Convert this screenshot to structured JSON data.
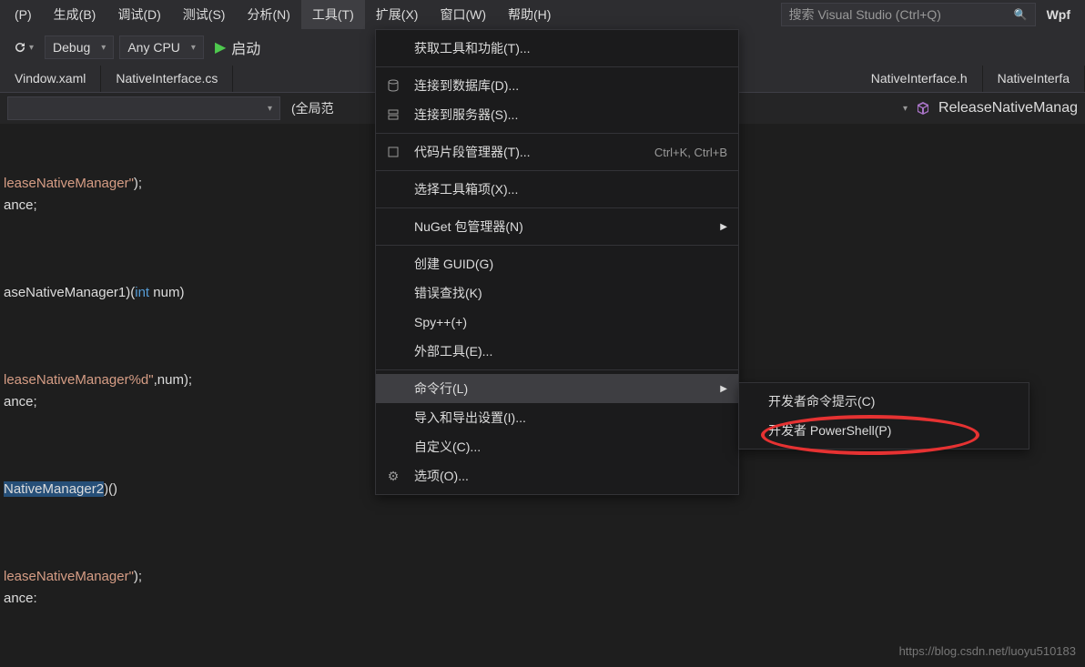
{
  "menubar": {
    "items": [
      "(P)",
      "生成(B)",
      "调试(D)",
      "测试(S)",
      "分析(N)",
      "工具(T)",
      "扩展(X)",
      "窗口(W)",
      "帮助(H)"
    ],
    "activeIndex": 5,
    "searchPlaceholder": "搜索 Visual Studio (Ctrl+Q)",
    "appTitle": "Wpf"
  },
  "toolbar": {
    "config": "Debug",
    "platform": "Any CPU",
    "runLabel": "启动"
  },
  "tabs": {
    "left": [
      "Vindow.xaml",
      "NativeInterface.cs"
    ],
    "right": [
      "NativeInterface.h",
      "NativeInterfa"
    ]
  },
  "scope": {
    "label": "(全局范",
    "rightLabel": "ReleaseNativeManag"
  },
  "dropdownMenu": {
    "items": [
      {
        "label": "获取工具和功能(T)...",
        "icon": ""
      },
      {
        "sep": true
      },
      {
        "label": "连接到数据库(D)...",
        "icon": "db"
      },
      {
        "label": "连接到服务器(S)...",
        "icon": "server"
      },
      {
        "sep": true
      },
      {
        "label": "代码片段管理器(T)...",
        "icon": "snippet",
        "shortcut": "Ctrl+K, Ctrl+B"
      },
      {
        "sep": true
      },
      {
        "label": "选择工具箱项(X)...",
        "icon": ""
      },
      {
        "sep": true
      },
      {
        "label": "NuGet 包管理器(N)",
        "icon": "",
        "arrow": true
      },
      {
        "sep": true
      },
      {
        "label": "创建 GUID(G)",
        "icon": ""
      },
      {
        "label": "错误查找(K)",
        "icon": ""
      },
      {
        "label": "Spy++(+)",
        "icon": ""
      },
      {
        "label": "外部工具(E)...",
        "icon": ""
      },
      {
        "sep": true
      },
      {
        "label": "命令行(L)",
        "icon": "",
        "arrow": true,
        "hover": true
      },
      {
        "label": "导入和导出设置(I)...",
        "icon": ""
      },
      {
        "label": "自定义(C)...",
        "icon": ""
      },
      {
        "label": "选项(O)...",
        "icon": "gear"
      }
    ]
  },
  "submenu": {
    "items": [
      {
        "label": "开发者命令提示(C)"
      },
      {
        "label": "开发者 PowerShell(P)"
      }
    ]
  },
  "code": {
    "line1a": "leaseNativeManager\"",
    "line1b": ");",
    "line2": "ance;",
    "line3a": "aseNativeManager1)(",
    "line3b": "int",
    "line3c": " num)",
    "line4a": "leaseNativeManager%d\"",
    "line4b": ",num);",
    "line5": "ance;",
    "line6a": "NativeManager2",
    "line6b": ")()",
    "line7a": "leaseNativeManager\"",
    "line7b": ");",
    "line8": "ance:"
  },
  "watermark": "https://blog.csdn.net/luoyu510183"
}
